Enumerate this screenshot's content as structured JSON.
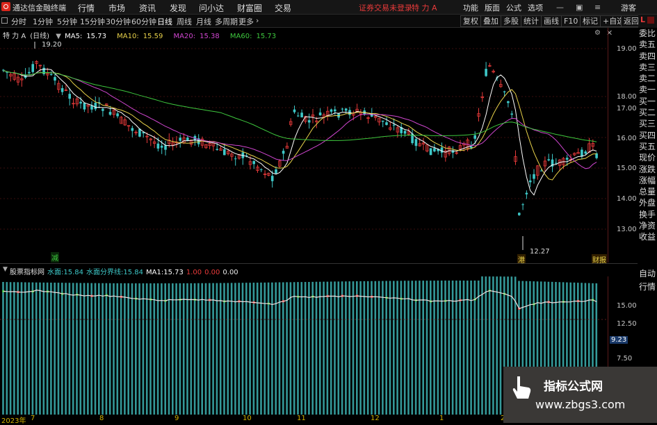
{
  "menubar": {
    "app_name": "通达信金融终端",
    "menus": [
      "行情",
      "市场",
      "资讯",
      "发现",
      "问小达",
      "财富圈",
      "交易"
    ],
    "login_status": "证券交易未登录",
    "stock_name": "特 力 A",
    "right_menus": [
      "功能",
      "版面",
      "公式",
      "选项"
    ],
    "guest": "游客"
  },
  "toolbar": {
    "periods": [
      "分时",
      "1分钟",
      "5分钟",
      "15分钟",
      "30分钟",
      "60分钟",
      "日线",
      "周线",
      "月线",
      "多周期",
      "更多"
    ],
    "active_period": "日线",
    "right_buttons": [
      "复权",
      "叠加",
      "多股",
      "统计",
      "画线",
      "F10",
      "标记",
      "+自选",
      "返回"
    ]
  },
  "main_chart": {
    "stock_label": "特 力 A",
    "period_label": "(日线)",
    "ma": [
      {
        "label": "MA5:",
        "value": "15.73",
        "color": "#ffffff"
      },
      {
        "label": "MA10:",
        "value": "15.59",
        "color": "#e8d24a"
      },
      {
        "label": "MA20:",
        "value": "15.38",
        "color": "#d046d0"
      },
      {
        "label": "MA60:",
        "value": "15.73",
        "color": "#3ec83e"
      }
    ],
    "y_ticks": [
      "19.00",
      "18.00",
      "17.00",
      "16.00",
      "15.00",
      "14.00",
      "13.00"
    ],
    "high_marker": "19.20",
    "low_marker": "12.27",
    "flag_jian": "减",
    "flag_gang": "港",
    "flag_caibao": "财报"
  },
  "right_list": [
    "委比",
    "卖五",
    "卖四",
    "卖三",
    "卖二",
    "卖一",
    "买一",
    "买二",
    "买三",
    "买四",
    "买五",
    "现价",
    "涨跌",
    "涨幅",
    "总量",
    "外盘",
    "换手",
    "净资",
    "收益"
  ],
  "right_tabs": [
    "自动",
    "行情"
  ],
  "lv_badge": "L",
  "indicator": {
    "name": "股票指标网",
    "items": [
      {
        "label": "水面:",
        "value": "15.84",
        "color": "#3ec8c8"
      },
      {
        "label": "水面分界线:",
        "value": "15.84",
        "color": "#3ec8c8"
      },
      {
        "label": "MA1:",
        "value": "15.73",
        "color": "#ffffff"
      },
      {
        "label": "",
        "value": "1.00",
        "color": "#e83a3a"
      },
      {
        "label": "",
        "value": "0.00",
        "color": "#e83a3a"
      },
      {
        "label": "",
        "value": "0.00",
        "color": "#e8e8e8"
      }
    ],
    "y_ticks": [
      "15.00",
      "12.50",
      "7.50"
    ],
    "value_box": "9.23"
  },
  "dates": [
    "2023年",
    "7",
    "8",
    "9",
    "10",
    "11",
    "12",
    "1",
    "2"
  ],
  "watermark": {
    "line1": "指标公式网",
    "line2": "www.zbgs3.com"
  },
  "colors": {
    "up": "#e83a3a",
    "down": "#3ec8c8",
    "ma5": "#ffffff",
    "ma10": "#e8d24a",
    "ma20": "#d046d0",
    "ma60": "#3ec83e"
  }
}
